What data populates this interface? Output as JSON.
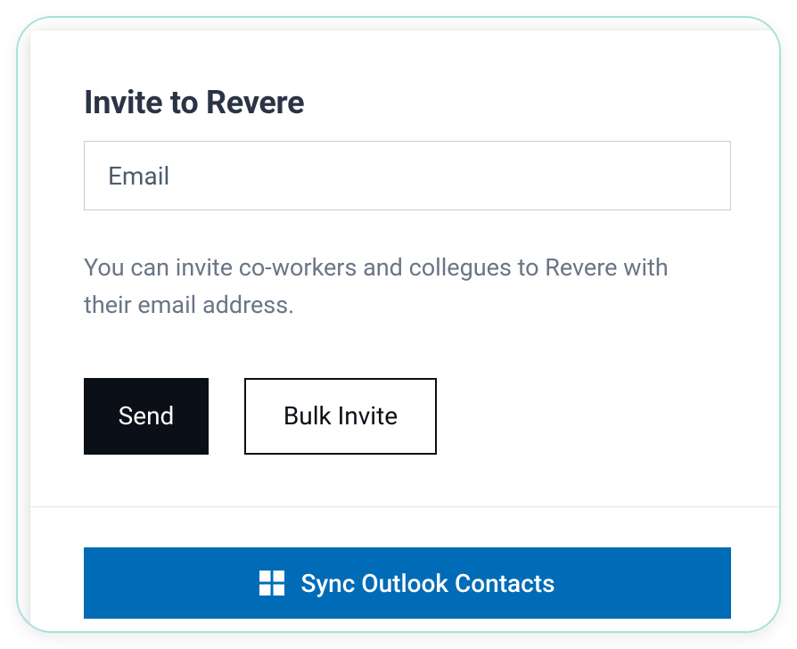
{
  "title": "Invite to Revere",
  "email": {
    "placeholder": "Email",
    "value": ""
  },
  "help_text": "You can invite co-workers and collegues to Revere with their email address.",
  "buttons": {
    "send": "Send",
    "bulk_invite": "Bulk Invite",
    "sync_outlook": "Sync Outlook Contacts"
  },
  "colors": {
    "accent_border": "#a8e0dc",
    "primary_button": "#0b0f17",
    "sync_button": "#006bb7",
    "heading": "#2a3445",
    "muted_text": "#6a7585"
  }
}
